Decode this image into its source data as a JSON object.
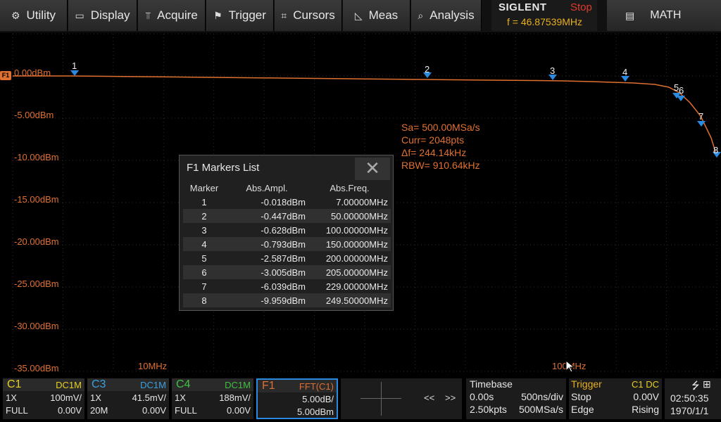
{
  "menu": [
    {
      "label": "Utility",
      "icon": "gear-icon"
    },
    {
      "label": "Display",
      "icon": "monitor-icon"
    },
    {
      "label": "Acquire",
      "icon": "acquire-icon"
    },
    {
      "label": "Trigger",
      "icon": "flag-icon"
    },
    {
      "label": "Cursors",
      "icon": "cursor-cross-icon"
    },
    {
      "label": "Meas",
      "icon": "ruler-icon"
    },
    {
      "label": "Analysis",
      "icon": "analysis-icon"
    }
  ],
  "brand": {
    "logo": "SIGLENT",
    "run_state": "Stop",
    "trigger_freq": "f = 46.87539MHz"
  },
  "math_button": {
    "label": "MATH",
    "icon": "memo-icon"
  },
  "trace_tag": "F1",
  "y_axis_labels": [
    "0.00dBm",
    "-5.00dBm",
    "-10.00dBm",
    "-15.00dBm",
    "-20.00dBm",
    "-25.00dBm",
    "-30.00dBm",
    "-35.00dBm"
  ],
  "x_axis_labels": [
    "10MHz",
    "100MHz"
  ],
  "fft_info": {
    "sa": "Sa=  500.00MSa/s",
    "curr": "Curr= 2048pts",
    "df": "Δf=  244.14kHz",
    "rbw": "RBW=  910.64kHz"
  },
  "markers_list": {
    "title": "F1 Markers List",
    "columns": [
      "Marker",
      "Abs.Ampl.",
      "Abs.Freq."
    ],
    "rows": [
      [
        "1",
        "-0.018dBm",
        "7.00000MHz"
      ],
      [
        "2",
        "-0.447dBm",
        "50.00000MHz"
      ],
      [
        "3",
        "-0.628dBm",
        "100.00000MHz"
      ],
      [
        "4",
        "-0.793dBm",
        "150.00000MHz"
      ],
      [
        "5",
        "-2.587dBm",
        "200.00000MHz"
      ],
      [
        "6",
        "-3.005dBm",
        "205.00000MHz"
      ],
      [
        "7",
        "-6.039dBm",
        "229.00000MHz"
      ],
      [
        "8",
        "-9.959dBm",
        "249.50000MHz"
      ]
    ]
  },
  "plot_markers": [
    "1",
    "2",
    "3",
    "4",
    "5",
    "6",
    "7",
    "8"
  ],
  "channels": [
    {
      "name": "C1",
      "coupling": "DC1M",
      "probe": "1X",
      "scale": "100mV/",
      "bw": "FULL",
      "offset": "0.00V",
      "color": "#e8d020"
    },
    {
      "name": "C3",
      "coupling": "DC1M",
      "probe": "1X",
      "scale": "41.5mV/",
      "bw": "20M",
      "offset": "0.00V",
      "color": "#3aa0e0"
    },
    {
      "name": "C4",
      "coupling": "DC1M",
      "probe": "1X",
      "scale": "188mV/",
      "bw": "FULL",
      "offset": "0.00V",
      "color": "#40c040"
    }
  ],
  "math_channel": {
    "name": "F1",
    "source": "FFT(C1)",
    "scale": "5.00dB/",
    "ref": "5.00dBm",
    "color": "#e07030"
  },
  "nav": {
    "prev": "<<",
    "next": ">>"
  },
  "timebase": {
    "label": "Timebase",
    "delay": "0.00s",
    "scale": "500ns/div",
    "points": "2.50kpts",
    "rate": "500MSa/s"
  },
  "trigger": {
    "label": "Trigger",
    "source": "C1 DC",
    "mode": "Stop",
    "level": "0.00V",
    "type": "Edge",
    "slope": "Rising"
  },
  "clock": {
    "time": "02:50:35",
    "date": "1970/1/1"
  },
  "colors": {
    "trace": "#e07030",
    "marker": "#2a8ae0",
    "accent": "#e8b020",
    "stop": "#e03a2a"
  }
}
